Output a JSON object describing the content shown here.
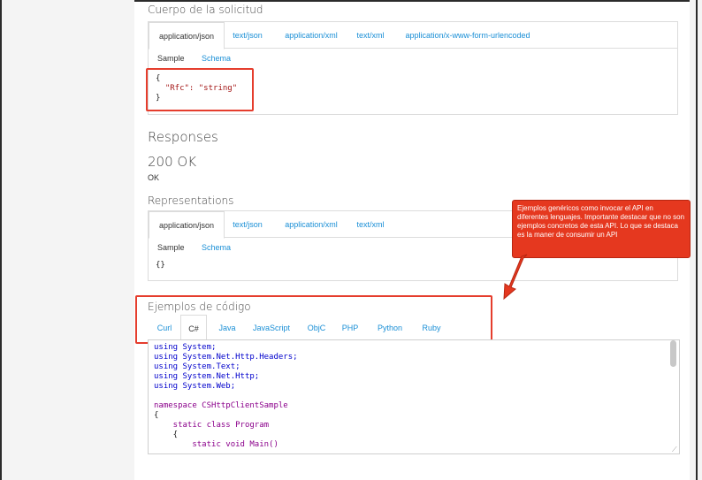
{
  "request": {
    "heading": "Cuerpo de la solicitud",
    "tabs": [
      "application/json",
      "text/json",
      "application/xml",
      "text/xml",
      "application/x-www-form-urlencoded"
    ],
    "subtabs": [
      "Sample",
      "Schema"
    ],
    "code": [
      "{",
      "  \"Rfc\": \"string\"",
      "}"
    ]
  },
  "responses": {
    "heading": "Responses",
    "status": "200 OK",
    "status_text": "OK",
    "representations_heading": "Representations",
    "tabs": [
      "application/json",
      "text/json",
      "application/xml",
      "text/xml"
    ],
    "subtabs": [
      "Sample",
      "Schema"
    ],
    "sample": "{}"
  },
  "code_examples": {
    "heading": "Ejemplos de código",
    "tabs": [
      "Curl",
      "C#",
      "Java",
      "JavaScript",
      "ObjC",
      "PHP",
      "Python",
      "Ruby"
    ],
    "active_tab": "C#",
    "lines": [
      "using System;",
      "using System.Net.Http.Headers;",
      "using System.Text;",
      "using System.Net.Http;",
      "using System.Web;",
      "",
      "namespace CSHttpClientSample",
      "{",
      "    static class Program",
      "    {",
      "        static void Main()"
    ]
  },
  "annotation": {
    "text": "Ejemplos genéricos como invocar el API en diferentes lenguajes. Importante destacar que no son ejemplos concretos de esta API. Lo que se destaca es la maner de consumir un API"
  },
  "colors": {
    "link": "#1a8fd6",
    "annotation": "#e5381f",
    "string": "#a31515",
    "keyword": "#8b008b"
  }
}
